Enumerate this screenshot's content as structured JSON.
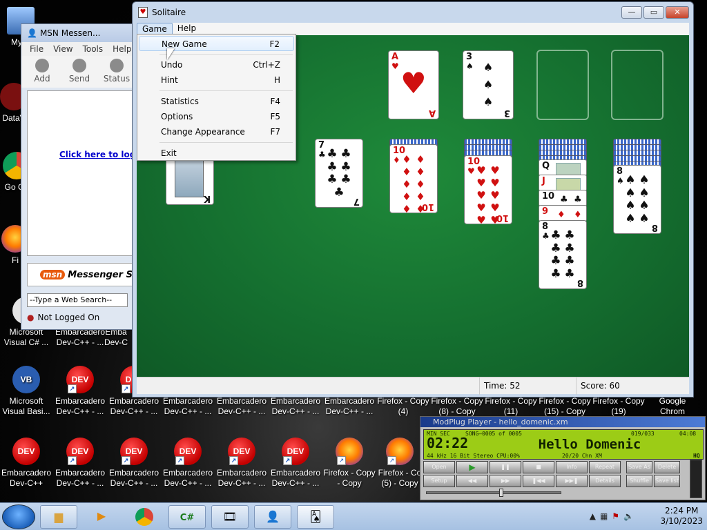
{
  "desktop": {
    "icons": [
      {
        "label": "My C",
        "type": "computer"
      },
      {
        "label": "DataV",
        "type": "app"
      },
      {
        "label": "Go Ch",
        "type": "chrome"
      },
      {
        "label": "Fi",
        "type": "firefox"
      },
      {
        "label": "Microsoft Visual C# ...",
        "type": "cs"
      },
      {
        "label": "Embarcadero Dev-C++ - ...",
        "type": "dev"
      },
      {
        "label": "Emba Dev-C",
        "type": "dev"
      },
      {
        "label": "Microsoft Visual Basi...",
        "type": "vb"
      },
      {
        "label": "Embarcadero Dev-C++ - ...",
        "type": "dev"
      },
      {
        "label": "Embarcadero Dev-C++ - ...",
        "type": "dev"
      },
      {
        "label": "Embarcadero Dev-C++ - ...",
        "type": "dev"
      },
      {
        "label": "Embarcadero Dev-C++ - ...",
        "type": "dev"
      },
      {
        "label": "Embarcadero Dev-C++ - ...",
        "type": "dev"
      },
      {
        "label": "Firefox - Copy (4)",
        "type": "firefox"
      },
      {
        "label": "Firefox - Copy (8) - Copy",
        "type": "firefox"
      },
      {
        "label": "Firefox - Copy (11)",
        "type": "firefox"
      },
      {
        "label": "Firefox - Copy (15) - Copy",
        "type": "firefox"
      },
      {
        "label": "Firefox - Copy (19)",
        "type": "firefox"
      },
      {
        "label": "Google Chrom",
        "type": "chrome"
      },
      {
        "label": "Embarcadero Dev-C++",
        "type": "dev"
      },
      {
        "label": "Embarcadero Dev-C++ - ...",
        "type": "dev"
      },
      {
        "label": "Embarcadero Dev-C++ - ...",
        "type": "dev"
      },
      {
        "label": "Embarcadero Dev-C++ - ...",
        "type": "dev"
      },
      {
        "label": "Embarcadero Dev-C++ - ...",
        "type": "dev"
      },
      {
        "label": "Embarcadero Dev-C++ - ...",
        "type": "dev"
      },
      {
        "label": "Firefox - Copy - Copy",
        "type": "firefox"
      },
      {
        "label": "Firefox - Co (5) - Copy",
        "type": "firefox"
      }
    ],
    "dev_badge": "DEV"
  },
  "msn": {
    "title": "MSN Messen...",
    "menu": [
      "File",
      "View",
      "Tools",
      "Help"
    ],
    "tools": [
      "Add",
      "Send",
      "Status"
    ],
    "logon_link": "Click here to log on",
    "banner": "Messenger Se",
    "banner_logo": "msn",
    "search_placeholder": "--Type a Web Search--",
    "status": "Not Logged On"
  },
  "solitaire": {
    "title": "Solitaire",
    "menu": {
      "game": "Game",
      "help": "Help"
    },
    "time_label": "Time:  52",
    "score_label": "Score: 60"
  },
  "game_menu": {
    "items": [
      {
        "label": "New Game",
        "shortcut": "F2"
      },
      {
        "label": "Undo",
        "shortcut": "Ctrl+Z"
      },
      {
        "label": "Hint",
        "shortcut": "H"
      },
      {
        "label": "Statistics",
        "shortcut": "F4"
      },
      {
        "label": "Options",
        "shortcut": "F5"
      },
      {
        "label": "Change Appearance",
        "shortcut": "F7"
      },
      {
        "label": "Exit",
        "shortcut": ""
      }
    ]
  },
  "cards": {
    "foundation_heart": {
      "rank": "A",
      "suit": "♥"
    },
    "foundation_spade": {
      "rank": "3",
      "suit": "♠"
    },
    "col1_king": {
      "rank": "K",
      "suit": "♠"
    },
    "col3": {
      "rank": "7",
      "suit": "♣"
    },
    "col4": {
      "rank": "10",
      "suit": "♦"
    },
    "col5": {
      "rank": "10",
      "suit": "♥"
    },
    "col6_strips": [
      {
        "rank": "Q",
        "suit": "♠"
      },
      {
        "rank": "J",
        "suit": "♦"
      },
      {
        "rank": "10",
        "suit": "♣"
      },
      {
        "rank": "9",
        "suit": "♦"
      }
    ],
    "col6_top": {
      "rank": "8",
      "suit": "♣"
    },
    "col7": {
      "rank": "8",
      "suit": "♠"
    }
  },
  "modplug": {
    "title": "ModPlug Player - hello_domenic.xm",
    "time": "02:22",
    "min_sec": "MIN  SEC",
    "song_counter": "SONG—0005 of 0005",
    "pos": "019/033",
    "total": "04:08",
    "song_name": "Hello Domenic",
    "info": "44 kHz  16 Bit Stereo CPU:00%",
    "chn": "20/20 Chn  XM",
    "hq": "HQ",
    "buttons": [
      "Open",
      "▶",
      "❚❚",
      "■",
      "Info",
      "Repeat",
      "Save As",
      "Delete",
      "Setup",
      "◀◀",
      "▶▶",
      "❚◀◀",
      "▶▶❚",
      "Details",
      "Shuffle",
      "Save list",
      "Clear",
      "About",
      "Playlist",
      "Save Wav",
      "Remove"
    ]
  },
  "taskbar": {
    "time": "2:24 PM",
    "date": "3/10/2023",
    "apps": [
      "explorer",
      "media-player",
      "chrome",
      "csharp",
      "movie",
      "msn",
      "solitaire"
    ]
  }
}
